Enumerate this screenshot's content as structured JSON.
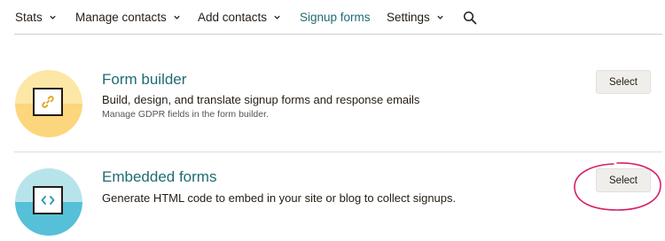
{
  "nav": {
    "items": [
      {
        "label": "Stats",
        "dropdown": true
      },
      {
        "label": "Manage contacts",
        "dropdown": true
      },
      {
        "label": "Add contacts",
        "dropdown": true
      },
      {
        "label": "Signup forms",
        "dropdown": false,
        "active": true
      },
      {
        "label": "Settings",
        "dropdown": true
      }
    ],
    "search_icon": "search-icon"
  },
  "options": [
    {
      "title": "Form builder",
      "description": "Build, design, and translate signup forms and response emails",
      "subtext": "Manage GDPR fields in the form builder.",
      "button_label": "Select",
      "icon": "link-icon",
      "circle_colors": {
        "top": "#fde7a6",
        "bottom": "#fbd67c"
      }
    },
    {
      "title": "Embedded forms",
      "description": "Generate HTML code to embed in your site or blog to collect signups.",
      "button_label": "Select",
      "icon": "code-icon",
      "circle_colors": {
        "top": "#b7e4ea",
        "bottom": "#56c0d8"
      },
      "annotation": "hand-drawn-circle-highlight"
    }
  ],
  "colors": {
    "accent": "#1f6b73",
    "annotation": "#d6206a",
    "button_bg": "#efeeea"
  }
}
